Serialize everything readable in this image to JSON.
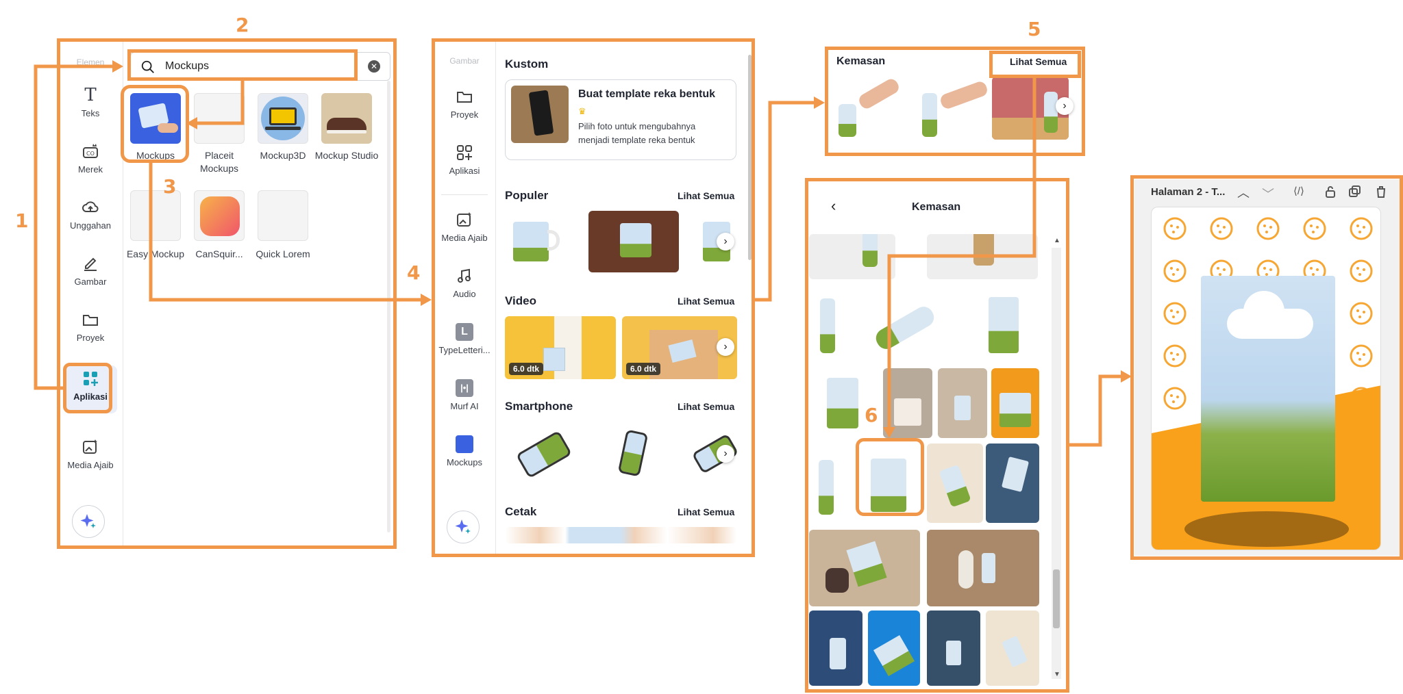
{
  "steps": [
    "1",
    "2",
    "3",
    "4",
    "5",
    "6"
  ],
  "panel1": {
    "search_value": "Mockups",
    "rail": [
      {
        "label": "Elemen",
        "icon": "elements-icon"
      },
      {
        "label": "Teks",
        "icon": "text-icon"
      },
      {
        "label": "Merek",
        "icon": "brand-icon"
      },
      {
        "label": "Unggahan",
        "icon": "upload-cloud-icon"
      },
      {
        "label": "Gambar",
        "icon": "draw-icon"
      },
      {
        "label": "Proyek",
        "icon": "folder-icon"
      },
      {
        "label": "Aplikasi",
        "icon": "apps-icon"
      },
      {
        "label": "Media Ajaib",
        "icon": "magic-media-icon"
      }
    ],
    "apps": [
      {
        "label": "Mockups"
      },
      {
        "label": "Placeit Mockups"
      },
      {
        "label": "Mockup3D"
      },
      {
        "label": "Mockup Studio"
      },
      {
        "label": "Easy Mockup"
      },
      {
        "label": "CanSquir..."
      },
      {
        "label": "Quick Lorem"
      }
    ]
  },
  "panel2": {
    "rail": [
      {
        "label": "Gambar"
      },
      {
        "label": "Proyek"
      },
      {
        "label": "Aplikasi"
      },
      {
        "label": "Media Ajaib"
      },
      {
        "label": "Audio"
      },
      {
        "label": "TypeLetteri..."
      },
      {
        "label": "Murf AI"
      },
      {
        "label": "Mockups"
      }
    ],
    "kustom": {
      "title": "Kustom",
      "card_title": "Buat template reka bentuk",
      "card_desc": "Pilih foto untuk mengubahnya menjadi template reka bentuk"
    },
    "sections": [
      {
        "title": "Populer",
        "see_all": "Lihat Semua"
      },
      {
        "title": "Video",
        "see_all": "Lihat Semua"
      },
      {
        "title": "Smartphone",
        "see_all": "Lihat Semua"
      },
      {
        "title": "Cetak",
        "see_all": "Lihat Semua"
      }
    ],
    "video_durations": [
      "6.0 dtk",
      "6.0 dtk"
    ]
  },
  "panel3": {
    "title": "Kemasan",
    "see_all": "Lihat Semua"
  },
  "panel4": {
    "title": "Kemasan"
  },
  "panel5": {
    "page_label": "Halaman 2 - T..."
  },
  "colors": {
    "accent_orange": "#f0974a",
    "canvas_orange": "#f9a11b",
    "pouch_green": "#7fa83a",
    "pouch_blue": "#c9def2"
  }
}
